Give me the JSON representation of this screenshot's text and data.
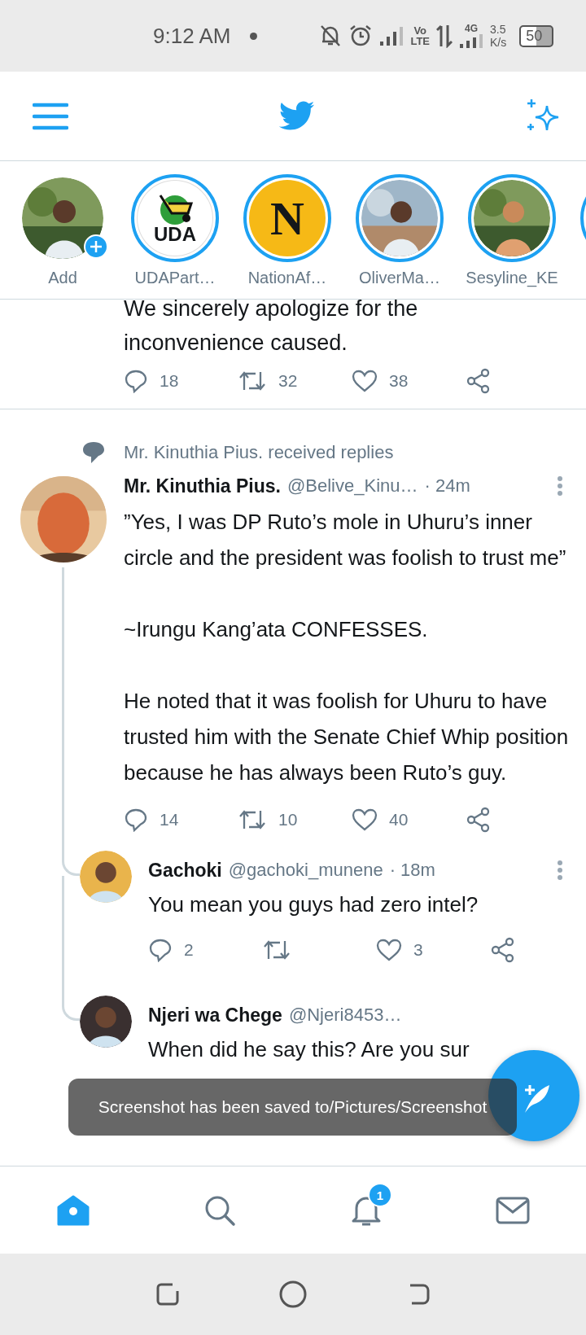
{
  "status_bar": {
    "time": "9:12 AM",
    "volte_top": "Vo",
    "volte_bottom": "LTE",
    "network": "4G",
    "speed": "3.5",
    "speed_unit": "K/s",
    "battery": "50"
  },
  "stories": [
    {
      "name": "Add",
      "ring": false,
      "add_badge": true
    },
    {
      "name": "UDAPart…",
      "kind": "logo",
      "logo_text": "UDA",
      "ring": true
    },
    {
      "name": "NationAf…",
      "kind": "letter",
      "logo_text": "N",
      "ring": true
    },
    {
      "name": "OliverMa…",
      "ring": true
    },
    {
      "name": "Sesyline_KE",
      "ring": true
    },
    {
      "ring": true
    }
  ],
  "partial_tweet": {
    "text": "We sincerely apologize for the inconvenience caused.",
    "actions": {
      "replies": "18",
      "retweets": "32",
      "likes": "38"
    }
  },
  "thread": {
    "context": "Mr. Kinuthia Pius. received replies",
    "name": "Mr. Kinuthia Pius.",
    "handle": "@Belive_Kinu…",
    "time": "· 24m",
    "paragraphs": [
      "”Yes, I was DP Ruto’s mole in Uhuru’s inner circle and the president was foolish to trust me”",
      "~Irungu Kang’ata CONFESSES.",
      "He noted that it was foolish for Uhuru to have trusted him with the Senate Chief Whip position because he has always been Ruto’s guy."
    ],
    "actions": {
      "replies": "14",
      "retweets": "10",
      "likes": "40"
    }
  },
  "replies": [
    {
      "name": "Gachoki",
      "handle": "@gachoki_munene",
      "time": "· 18m",
      "text": "You mean you guys had zero intel?",
      "actions": {
        "replies": "2",
        "likes": "3"
      }
    },
    {
      "name": "Njeri wa Chege",
      "handle": "@Njeri8453…",
      "text": "When did he say this? Are you sur"
    }
  ],
  "toast": "Screenshot has been saved to/Pictures/Screenshot",
  "bottom_nav": [
    {
      "kind": "home",
      "selected": true
    },
    {
      "kind": "search",
      "selected": false
    },
    {
      "kind": "notifications",
      "selected": false,
      "badge": "1"
    },
    {
      "kind": "messages",
      "selected": false
    }
  ]
}
